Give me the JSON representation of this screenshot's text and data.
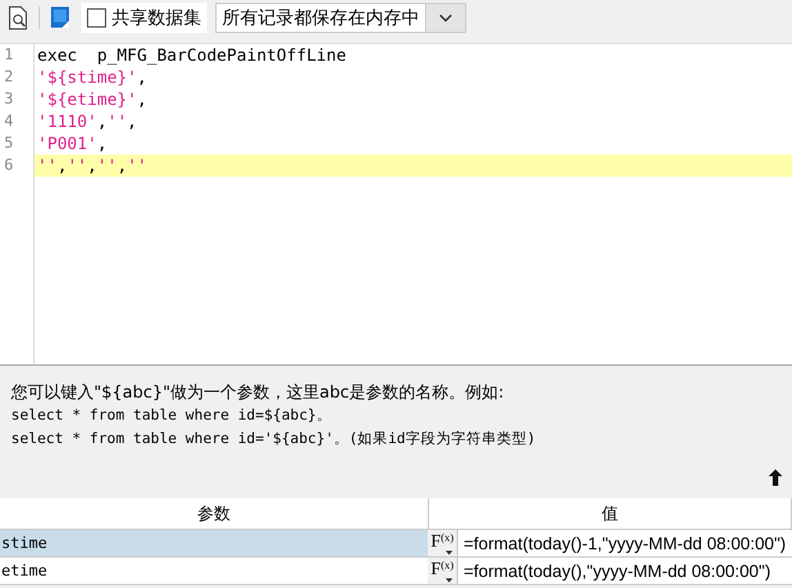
{
  "toolbar": {
    "share_checkbox": {
      "label": "共享数据集",
      "checked": false
    },
    "storage_select": {
      "value": "所有记录都保存在内存中"
    }
  },
  "editor": {
    "lines": [
      {
        "number": "1",
        "highlighted": false,
        "tokens": [
          {
            "kind": "plain",
            "text": "exec  p_MFG_BarCodePaintOffLine"
          }
        ]
      },
      {
        "number": "2",
        "highlighted": false,
        "tokens": [
          {
            "kind": "string",
            "text": "'${stime}'"
          },
          {
            "kind": "plain",
            "text": ","
          }
        ]
      },
      {
        "number": "3",
        "highlighted": false,
        "tokens": [
          {
            "kind": "string",
            "text": "'${etime}'"
          },
          {
            "kind": "plain",
            "text": ","
          }
        ]
      },
      {
        "number": "4",
        "highlighted": false,
        "tokens": [
          {
            "kind": "string",
            "text": "'1110'"
          },
          {
            "kind": "plain",
            "text": ","
          },
          {
            "kind": "string",
            "text": "''"
          },
          {
            "kind": "plain",
            "text": ","
          }
        ]
      },
      {
        "number": "5",
        "highlighted": false,
        "tokens": [
          {
            "kind": "string",
            "text": "'P001'"
          },
          {
            "kind": "plain",
            "text": ","
          }
        ]
      },
      {
        "number": "6",
        "highlighted": true,
        "tokens": [
          {
            "kind": "string",
            "text": "''"
          },
          {
            "kind": "plain",
            "text": ","
          },
          {
            "kind": "string",
            "text": "''"
          },
          {
            "kind": "plain",
            "text": ","
          },
          {
            "kind": "string",
            "text": "''"
          },
          {
            "kind": "plain",
            "text": ","
          },
          {
            "kind": "string",
            "text": "''"
          }
        ]
      }
    ]
  },
  "hint": {
    "lines": [
      "您可以键入\"${abc}\"做为一个参数，这里abc是参数的名称。例如:",
      "select * from table where id=${abc}。",
      "select * from table where id='${abc}'。(如果id字段为字符串类型)"
    ]
  },
  "params_table": {
    "columns": [
      "参数",
      "值"
    ],
    "rows": [
      {
        "name": "stime",
        "formula_button": {
          "letter": "F",
          "sub": "(x)"
        },
        "value": "=format(today()-1,\"yyyy-MM-dd 08:00:00\")",
        "selected": true
      },
      {
        "name": "etime",
        "formula_button": {
          "letter": "F",
          "sub": "(x)"
        },
        "value": "=format(today(),\"yyyy-MM-dd 08:00:00\")",
        "selected": false
      }
    ]
  }
}
